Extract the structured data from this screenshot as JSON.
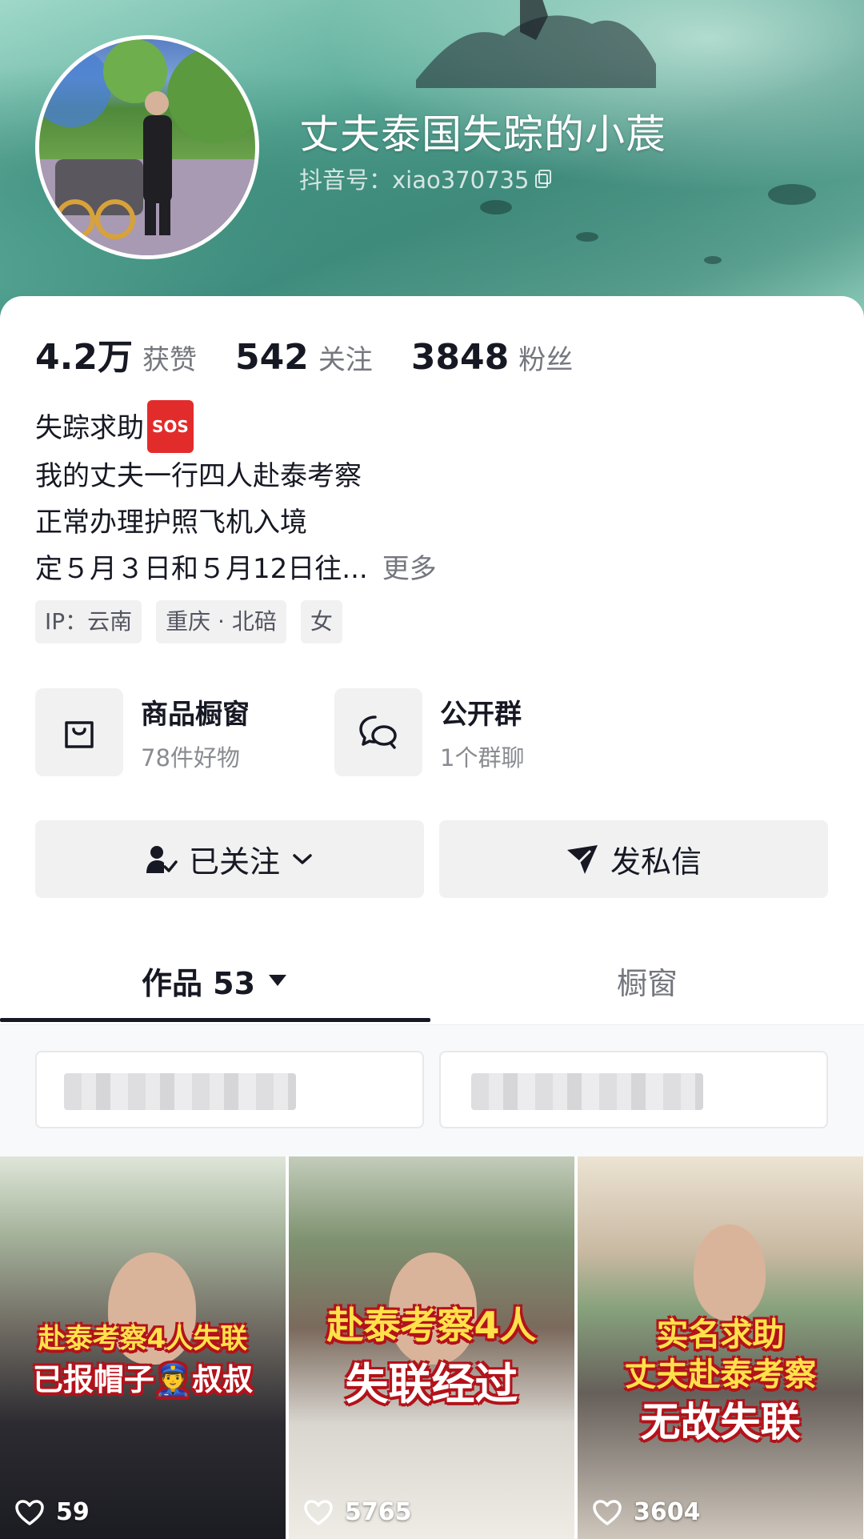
{
  "profile": {
    "name": "丈夫泰国失踪的小莀",
    "douyin_id": "抖音号：xiao370735"
  },
  "stats": [
    {
      "value": "4.2万",
      "label": "获赞"
    },
    {
      "value": "542",
      "label": "关注"
    },
    {
      "value": "3848",
      "label": "粉丝"
    }
  ],
  "bio": {
    "line1": "失踪求助",
    "sos": "SOS",
    "line2": "我的丈夫一行四人赴泰考察",
    "line3": "正常办理护照飞机入境",
    "line4": "定５月３日和５月12日往...",
    "more": "更多"
  },
  "tags": [
    "IP：云南",
    "重庆 · 北碚",
    "女"
  ],
  "entries": {
    "shop": {
      "title": "商品橱窗",
      "subtitle": "78件好物"
    },
    "group": {
      "title": "公开群",
      "subtitle": "1个群聊"
    }
  },
  "actions": {
    "follow": "已关注",
    "message": "发私信"
  },
  "tabs": {
    "works": "作品 53",
    "showcase": "橱窗"
  },
  "videos": [
    {
      "caption1": "赴泰考察4人失联",
      "caption2": "已报帽子👮叔叔",
      "likes": "59"
    },
    {
      "caption1": "赴泰考察4人",
      "caption2": "失联经过",
      "likes": "5765"
    },
    {
      "caption1": "实名求助",
      "caption2": "丈夫赴泰考察",
      "caption3": "无故失联",
      "likes": "3604"
    }
  ],
  "colors": {
    "header_teal": "#5fae9c",
    "text_primary": "#161823",
    "text_secondary": "#75777f",
    "sos_red": "#e22c2c"
  }
}
